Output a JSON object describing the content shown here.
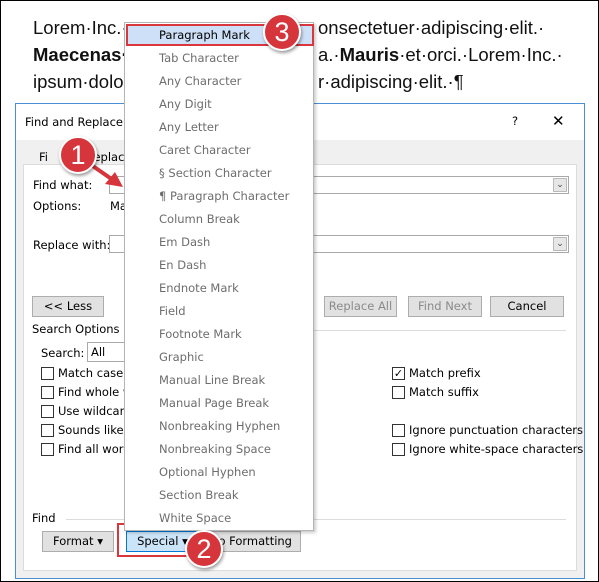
{
  "document": {
    "lines": [
      "Lorem·Inc.·",
      "onsectetuer·adipiscing·elit.·",
      "Maecenas·",
      "a.·",
      "Mauris",
      "·et·orci.·Lorem·Inc.·",
      "ipsum·dolo",
      "r·adipiscing·elit.·¶"
    ]
  },
  "dialog": {
    "title": "Find and Replace",
    "help": "?",
    "close": "✕",
    "tabs": [
      "Fi",
      "Replace"
    ],
    "find_label": "Find what:",
    "options_label": "Options:",
    "options_value": "Ma",
    "replace_label": "Replace with:",
    "buttons": {
      "less": "<< Less",
      "replace_all": "Replace All",
      "find_next": "Find Next",
      "cancel": "Cancel"
    },
    "search_options": "Search Options",
    "search_label": "Search:",
    "search_value": "All",
    "left_checks": [
      {
        "label": "Match case",
        "checked": false
      },
      {
        "label": "Find whole w",
        "checked": false
      },
      {
        "label": "Use wildcard",
        "checked": false
      },
      {
        "label": "Sounds like (",
        "checked": false
      },
      {
        "label": "Find all word",
        "checked": false
      }
    ],
    "right_checks": [
      {
        "label": "Match prefix",
        "checked": true
      },
      {
        "label": "Match suffix",
        "checked": false
      },
      {
        "label": "Ignore punctuation characters",
        "checked": false
      },
      {
        "label": "Ignore white-space characters",
        "checked": false
      }
    ],
    "find_section": "Find",
    "format": "Format ▾",
    "special": "Special ▾",
    "no_formatting": "No Formatting"
  },
  "menu": {
    "items": [
      "Paragraph Mark",
      "Tab Character",
      "Any Character",
      "Any Digit",
      "Any Letter",
      "Caret Character",
      "§ Section Character",
      "¶ Paragraph Character",
      "Column Break",
      "Em Dash",
      "En Dash",
      "Endnote Mark",
      "Field",
      "Footnote Mark",
      "Graphic",
      "Manual Line Break",
      "Manual Page Break",
      "Nonbreaking Hyphen",
      "Nonbreaking Space",
      "Optional Hyphen",
      "Section Break",
      "White Space"
    ],
    "highlighted": "Paragraph Mark"
  },
  "badges": [
    "1",
    "2",
    "3"
  ],
  "colors": {
    "badge": "#d5353b",
    "highlight": "#cde0f7",
    "dialog_border": "#4a8fd6"
  }
}
